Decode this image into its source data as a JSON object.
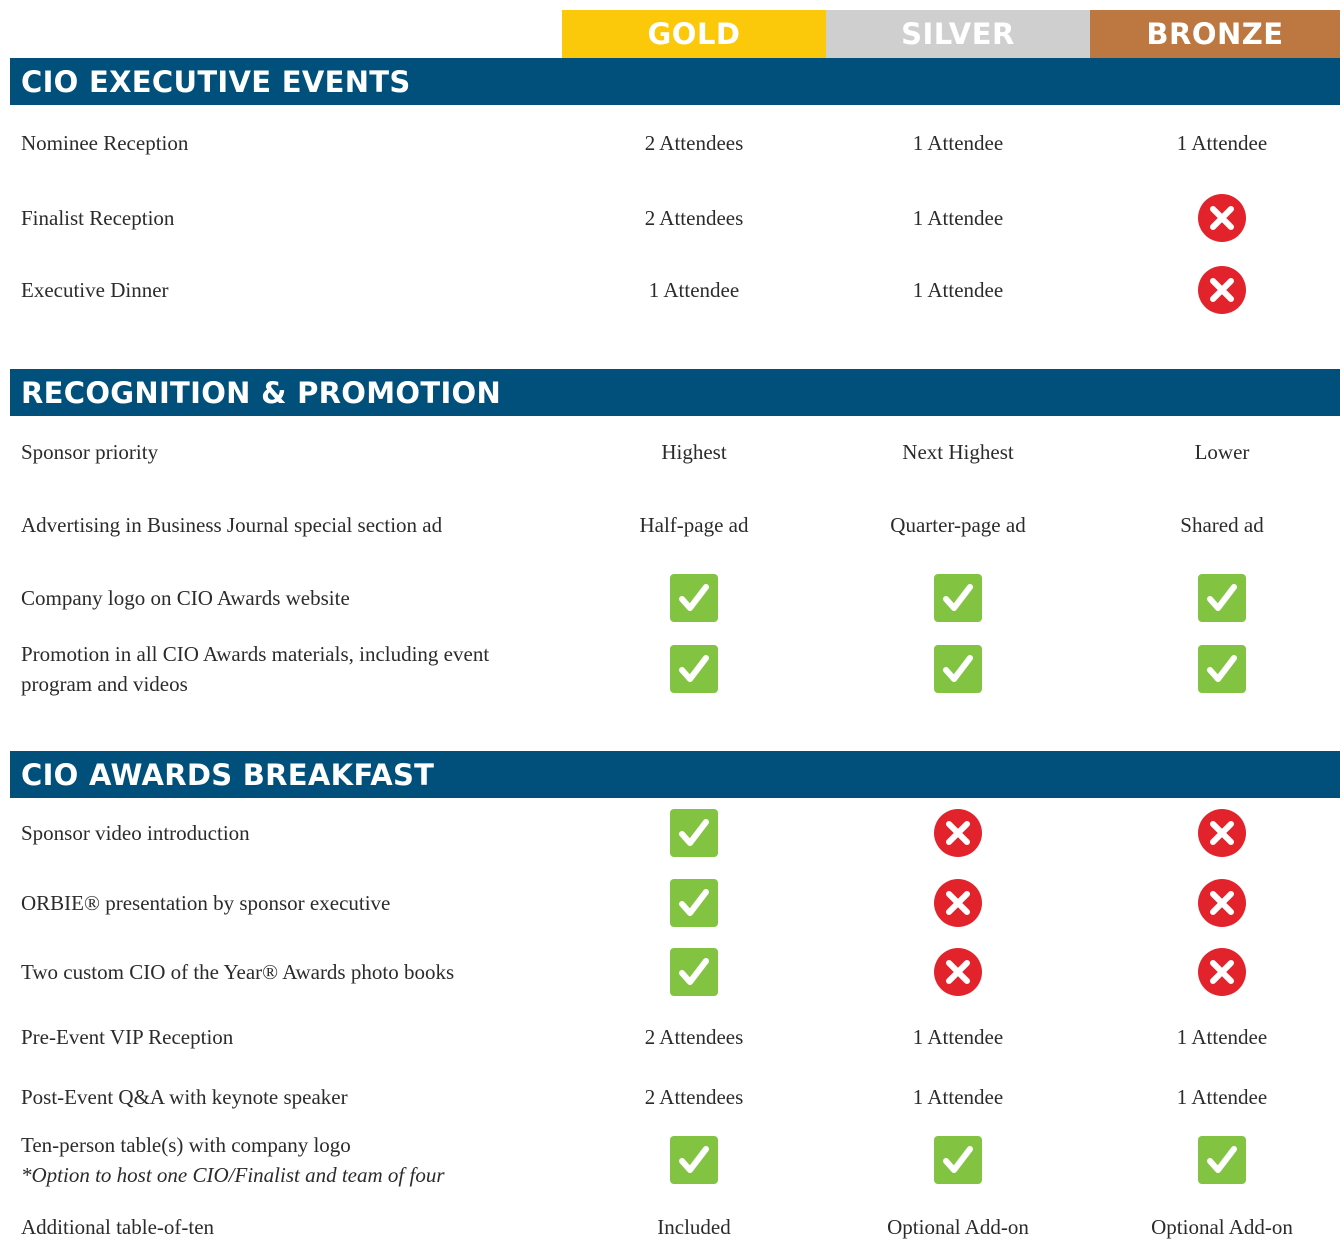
{
  "colors": {
    "gold": "#fcc80a",
    "silver": "#cfcfcf",
    "bronze": "#bd7741",
    "section": "#00507c",
    "check": "#82c341",
    "cross": "#e3232c"
  },
  "tiers": [
    "GOLD",
    "SILVER",
    "BRONZE"
  ],
  "sections": [
    {
      "title": "CIO EXECUTIVE EVENTS",
      "rows": [
        {
          "label": "Nominee Reception",
          "cells": [
            "2 Attendees",
            "1 Attendee",
            "1 Attendee"
          ]
        },
        {
          "label": "Finalist Reception",
          "cells": [
            "2 Attendees",
            "1 Attendee",
            "cross"
          ]
        },
        {
          "label": "Executive Dinner",
          "cells": [
            "1 Attendee",
            "1 Attendee",
            "cross"
          ]
        }
      ]
    },
    {
      "title": "RECOGNITION & PROMOTION",
      "rows": [
        {
          "label": "Sponsor priority",
          "cells": [
            "Highest",
            "Next Highest",
            "Lower"
          ]
        },
        {
          "label": "Advertising in Business Journal special section ad",
          "cells": [
            "Half-page ad",
            "Quarter-page ad",
            "Shared ad"
          ]
        },
        {
          "label": "Company logo on CIO Awards website",
          "cells": [
            "check",
            "check",
            "check"
          ]
        },
        {
          "label": "Promotion in all CIO Awards materials, including event program and videos",
          "cells": [
            "check",
            "check",
            "check"
          ]
        }
      ]
    },
    {
      "title": "CIO AWARDS BREAKFAST",
      "rows": [
        {
          "label": "Sponsor video introduction",
          "cells": [
            "check",
            "cross",
            "cross"
          ]
        },
        {
          "label": "ORBIE® presentation by sponsor executive",
          "cells": [
            "check",
            "cross",
            "cross"
          ]
        },
        {
          "label": "Two custom CIO of the Year® Awards photo books",
          "cells": [
            "check",
            "cross",
            "cross"
          ]
        },
        {
          "label": "Pre-Event VIP Reception",
          "cells": [
            "2 Attendees",
            "1 Attendee",
            "1 Attendee"
          ]
        },
        {
          "label": "Post-Event Q&A with keynote speaker",
          "cells": [
            "2 Attendees",
            "1 Attendee",
            "1 Attendee"
          ]
        },
        {
          "label": "Ten-person table(s) with company logo",
          "note": "*Option to host one CIO/Finalist and team of four",
          "cells": [
            "check",
            "check",
            "check"
          ]
        },
        {
          "label": "Additional table-of-ten",
          "cells": [
            "Included",
            "Optional Add-on",
            "Optional Add-on"
          ]
        }
      ]
    }
  ]
}
